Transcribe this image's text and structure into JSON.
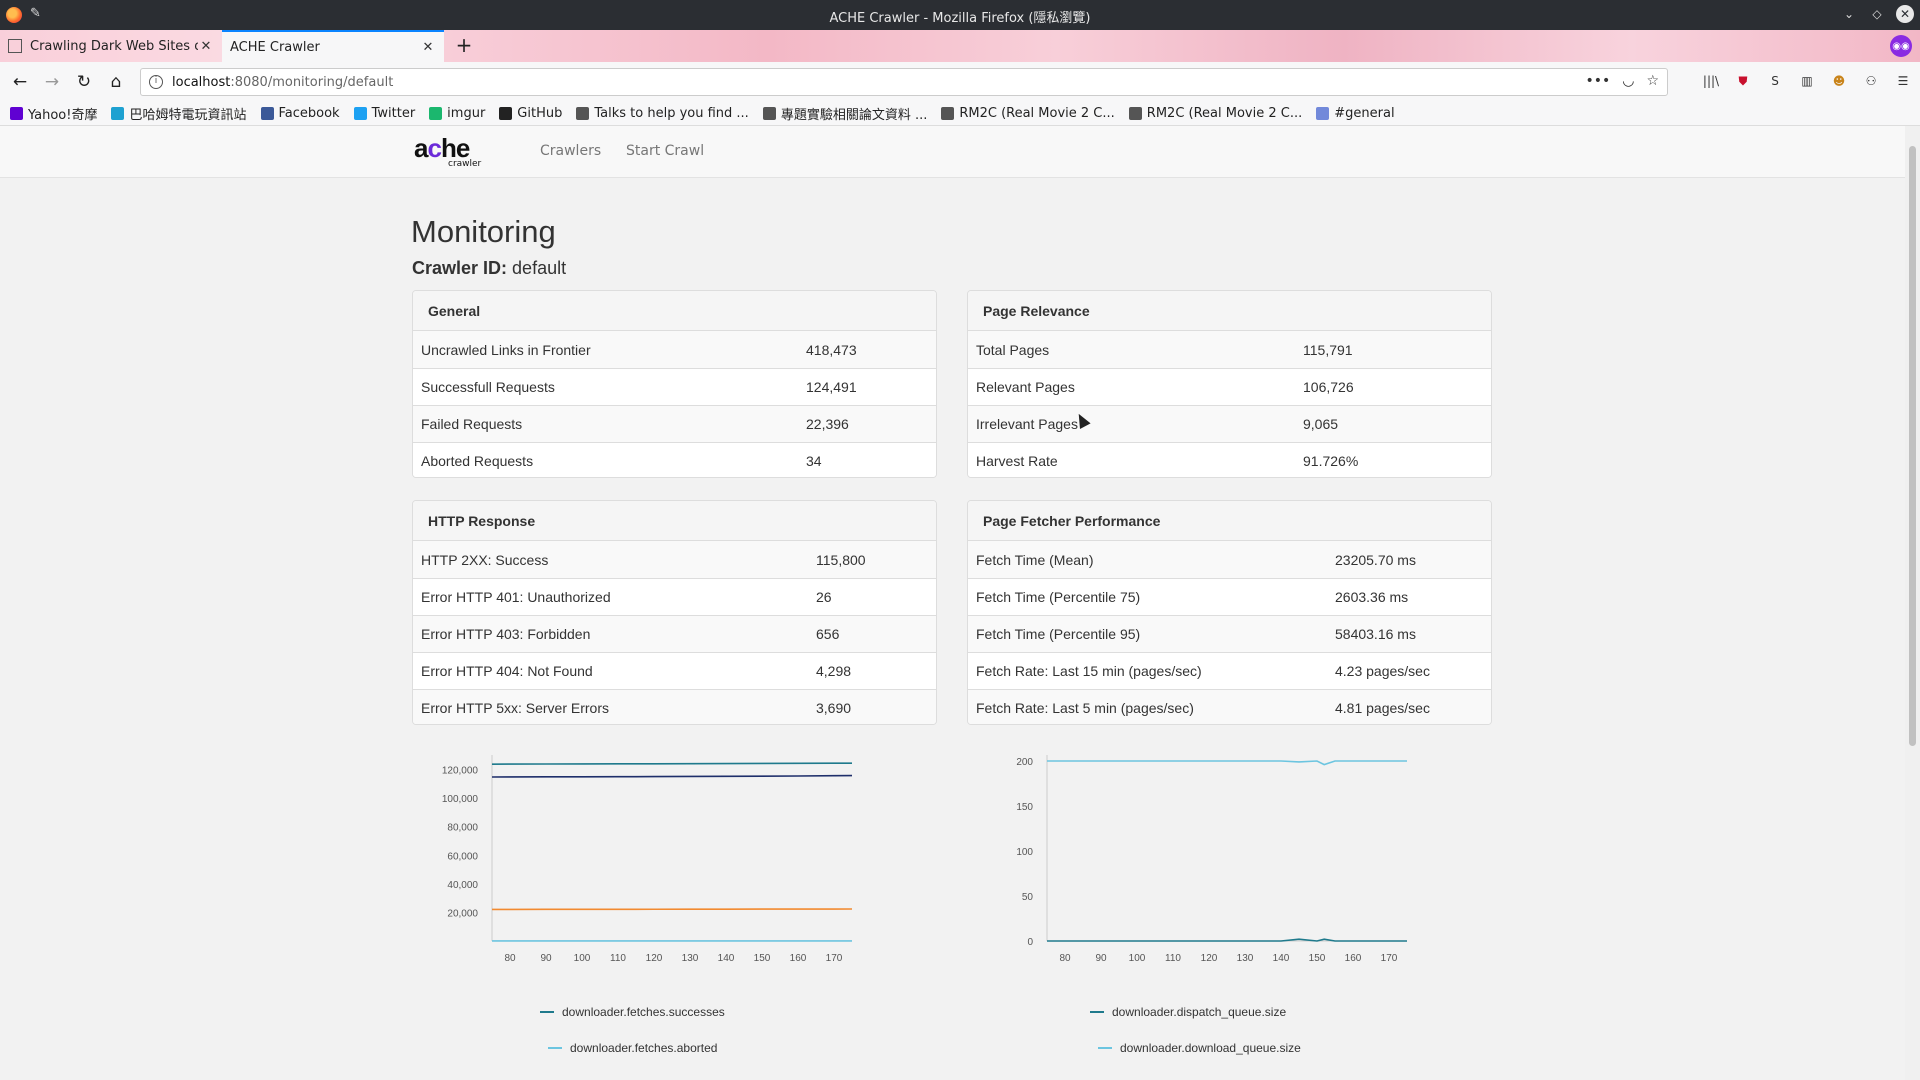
{
  "window": {
    "title": "ACHE Crawler - Mozilla Firefox (隱私瀏覽)"
  },
  "tabs": [
    {
      "label": "Crawling Dark Web Sites on"
    },
    {
      "label": "ACHE Crawler"
    }
  ],
  "url": {
    "host": "localhost",
    "path": ":8080/monitoring/default"
  },
  "bookmarks": [
    {
      "label": "Yahoo!奇摩",
      "color": "#6001d2"
    },
    {
      "label": "巴哈姆特電玩資訊站",
      "color": "#1ea1d1"
    },
    {
      "label": "Facebook",
      "color": "#3b5998"
    },
    {
      "label": "Twitter",
      "color": "#1da1f2"
    },
    {
      "label": "imgur",
      "color": "#1bb76e"
    },
    {
      "label": "GitHub",
      "color": "#222222"
    },
    {
      "label": "Talks to help you find ...",
      "color": "#555555"
    },
    {
      "label": "專題實驗相關論文資料 ...",
      "color": "#555555"
    },
    {
      "label": "RM2C (Real Movie 2 C...",
      "color": "#555555"
    },
    {
      "label": "RM2C (Real Movie 2 C...",
      "color": "#555555"
    },
    {
      "label": "#general",
      "color": "#7289da"
    }
  ],
  "site": {
    "brand_main": "ache",
    "brand_sub": "crawler",
    "nav": [
      "Crawlers",
      "Start Crawl"
    ]
  },
  "page": {
    "title": "Monitoring",
    "crawler_id_label": "Crawler ID:",
    "crawler_id_value": "default"
  },
  "panels": {
    "general": {
      "heading": "General",
      "rows": [
        {
          "label": "Uncrawled Links in Frontier",
          "value": "418,473"
        },
        {
          "label": "Successfull Requests",
          "value": "124,491"
        },
        {
          "label": "Failed Requests",
          "value": "22,396"
        },
        {
          "label": "Aborted Requests",
          "value": "34"
        }
      ]
    },
    "relevance": {
      "heading": "Page Relevance",
      "rows": [
        {
          "label": "Total Pages",
          "value": "115,791"
        },
        {
          "label": "Relevant Pages",
          "value": "106,726"
        },
        {
          "label": "Irrelevant Pages",
          "value": "9,065"
        },
        {
          "label": "Harvest Rate",
          "value": "91.726%"
        }
      ]
    },
    "http": {
      "heading": "HTTP Response",
      "rows": [
        {
          "label": "HTTP 2XX: Success",
          "value": "115,800"
        },
        {
          "label": "Error HTTP 401: Unauthorized",
          "value": "26"
        },
        {
          "label": "Error HTTP 403: Forbidden",
          "value": "656"
        },
        {
          "label": "Error HTTP 404: Not Found",
          "value": "4,298"
        },
        {
          "label": "Error HTTP 5xx: Server Errors",
          "value": "3,690"
        }
      ]
    },
    "fetcher": {
      "heading": "Page Fetcher Performance",
      "rows": [
        {
          "label": "Fetch Time (Mean)",
          "value": "23205.70 ms"
        },
        {
          "label": "Fetch Time (Percentile 75)",
          "value": "2603.36 ms"
        },
        {
          "label": "Fetch Time (Percentile 95)",
          "value": "58403.16 ms"
        },
        {
          "label": "Fetch Rate: Last 15 min (pages/sec)",
          "value": "4.23 pages/sec"
        },
        {
          "label": "Fetch Rate: Last 5 min (pages/sec)",
          "value": "4.81 pages/sec"
        }
      ]
    }
  },
  "chart_data": [
    {
      "type": "line",
      "x": [
        75,
        80,
        90,
        100,
        110,
        120,
        130,
        140,
        150,
        160,
        170,
        175
      ],
      "xticks": [
        80,
        90,
        100,
        110,
        120,
        130,
        140,
        150,
        160,
        170
      ],
      "yticks": [
        20000,
        40000,
        60000,
        80000,
        100000,
        120000
      ],
      "ytick_labels": [
        "20,000",
        "40,000",
        "60,000",
        "80,000",
        "100,000",
        "120,000"
      ],
      "ylim": [
        0,
        126000
      ],
      "xlim": [
        75,
        175
      ],
      "series": [
        {
          "name": "downloader.fetches.successes",
          "color": "#1f7a8c",
          "values": [
            123800,
            123850,
            123900,
            123950,
            124000,
            124050,
            124100,
            124200,
            124300,
            124350,
            124450,
            124491
          ],
          "legend": true
        },
        {
          "name": "",
          "color": "#1f2f6b",
          "values": [
            114800,
            114850,
            114900,
            114950,
            115000,
            115100,
            115200,
            115300,
            115400,
            115500,
            115700,
            115791
          ],
          "legend": false
        },
        {
          "name": "",
          "color": "#f28a30",
          "values": [
            22100,
            22120,
            22150,
            22180,
            22200,
            22230,
            22260,
            22300,
            22330,
            22350,
            22380,
            22396
          ],
          "legend": false
        },
        {
          "name": "downloader.fetches.aborted",
          "color": "#6cc5e0",
          "values": [
            34,
            34,
            34,
            34,
            34,
            34,
            34,
            34,
            34,
            34,
            34,
            34
          ],
          "legend": true
        }
      ]
    },
    {
      "type": "line",
      "x": [
        75,
        80,
        90,
        100,
        110,
        120,
        130,
        140,
        145,
        150,
        152,
        155,
        160,
        170,
        175
      ],
      "xticks": [
        80,
        90,
        100,
        110,
        120,
        130,
        140,
        150,
        160,
        170
      ],
      "yticks": [
        0,
        50,
        100,
        150,
        200
      ],
      "ytick_labels": [
        "0",
        "50",
        "100",
        "150",
        "200"
      ],
      "ylim": [
        0,
        200
      ],
      "xlim": [
        75,
        175
      ],
      "series": [
        {
          "name": "downloader.dispatch_queue.size",
          "color": "#1f7a8c",
          "values": [
            0,
            0,
            0,
            0,
            0,
            0,
            0,
            0,
            2,
            0,
            2,
            0,
            0,
            0,
            0
          ],
          "legend": true
        },
        {
          "name": "downloader.download_queue.size",
          "color": "#6cc5e0",
          "values": [
            200,
            200,
            200,
            200,
            200,
            200,
            200,
            200,
            199,
            200,
            196,
            200,
            200,
            200,
            200
          ],
          "legend": true
        }
      ]
    }
  ]
}
